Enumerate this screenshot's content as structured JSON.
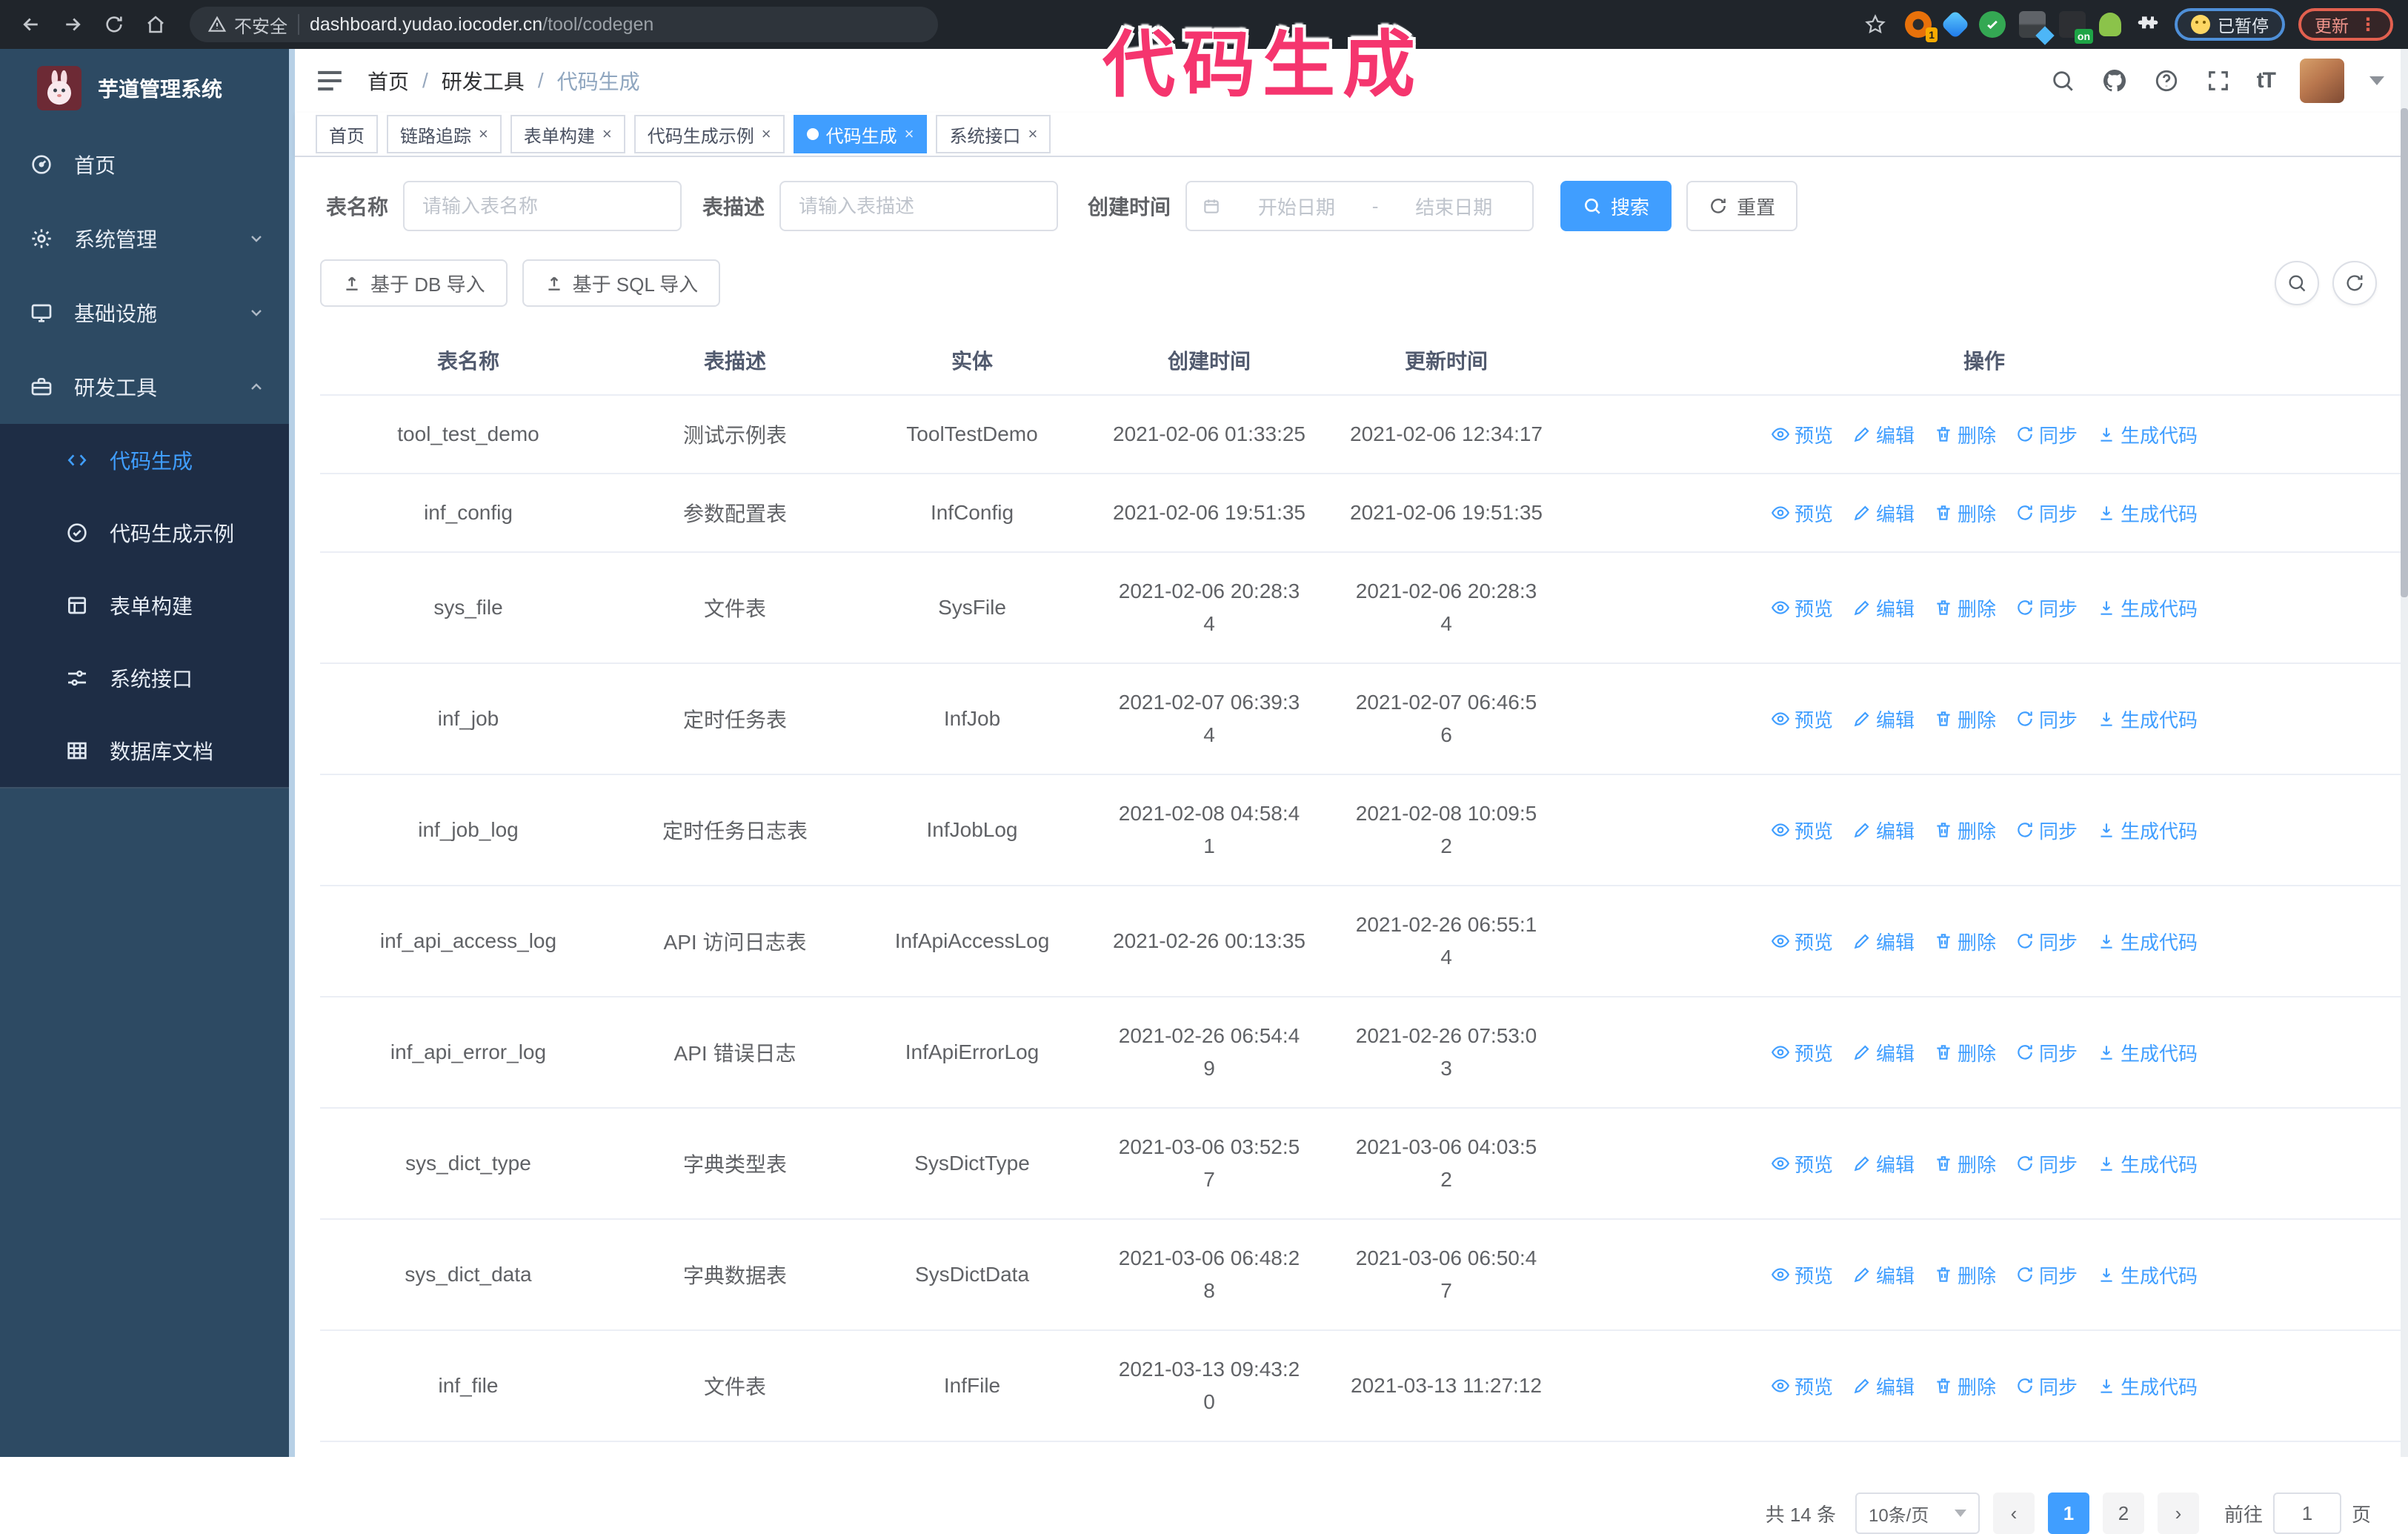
{
  "browser": {
    "security_label": "不安全",
    "url_host": "dashboard.yudao.iocoder.cn",
    "url_path": "/tool/codegen",
    "paused_badge": "已暂停",
    "update_label": "更新",
    "ext_badge_one": "1",
    "ext_badge_on": "on"
  },
  "annotation": {
    "text": "代码生成",
    "color": "#f5356e"
  },
  "sidebar": {
    "title": "芋道管理系统",
    "items": [
      {
        "label": "首页"
      },
      {
        "label": "系统管理"
      },
      {
        "label": "基础设施"
      },
      {
        "label": "研发工具"
      }
    ],
    "submenu": [
      {
        "label": "代码生成"
      },
      {
        "label": "代码生成示例"
      },
      {
        "label": "表单构建"
      },
      {
        "label": "系统接口"
      },
      {
        "label": "数据库文档"
      }
    ]
  },
  "header": {
    "breadcrumb": [
      "首页",
      "研发工具",
      "代码生成"
    ]
  },
  "tabs": [
    {
      "label": "首页"
    },
    {
      "label": "链路追踪"
    },
    {
      "label": "表单构建"
    },
    {
      "label": "代码生成示例"
    },
    {
      "label": "代码生成"
    },
    {
      "label": "系统接口"
    }
  ],
  "filters": {
    "table_name_label": "表名称",
    "table_name_placeholder": "请输入表名称",
    "table_desc_label": "表描述",
    "table_desc_placeholder": "请输入表描述",
    "create_time_label": "创建时间",
    "date_start_placeholder": "开始日期",
    "date_separator": "-",
    "date_end_placeholder": "结束日期",
    "search_label": "搜索",
    "reset_label": "重置"
  },
  "toolbar": {
    "import_db": "基于 DB 导入",
    "import_sql": "基于 SQL 导入"
  },
  "table": {
    "columns": [
      "表名称",
      "表描述",
      "实体",
      "创建时间",
      "更新时间",
      "操作"
    ],
    "actions": [
      "预览",
      "编辑",
      "删除",
      "同步",
      "生成代码"
    ],
    "rows": [
      {
        "name": "tool_test_demo",
        "desc": "测试示例表",
        "entity": "ToolTestDemo",
        "created": "2021-02-06 01:33:25",
        "updated": "2021-02-06 12:34:17"
      },
      {
        "name": "inf_config",
        "desc": "参数配置表",
        "entity": "InfConfig",
        "created": "2021-02-06 19:51:35",
        "updated": "2021-02-06 19:51:35"
      },
      {
        "name": "sys_file",
        "desc": "文件表",
        "entity": "SysFile",
        "created": "2021-02-06 20:28:3\n4",
        "updated": "2021-02-06 20:28:3\n4"
      },
      {
        "name": "inf_job",
        "desc": "定时任务表",
        "entity": "InfJob",
        "created": "2021-02-07 06:39:3\n4",
        "updated": "2021-02-07 06:46:5\n6"
      },
      {
        "name": "inf_job_log",
        "desc": "定时任务日志表",
        "entity": "InfJobLog",
        "created": "2021-02-08 04:58:4\n1",
        "updated": "2021-02-08 10:09:5\n2"
      },
      {
        "name": "inf_api_access_log",
        "desc": "API 访问日志表",
        "entity": "InfApiAccessLog",
        "created": "2021-02-26 00:13:35",
        "updated": "2021-02-26 06:55:1\n4"
      },
      {
        "name": "inf_api_error_log",
        "desc": "API 错误日志",
        "entity": "InfApiErrorLog",
        "created": "2021-02-26 06:54:4\n9",
        "updated": "2021-02-26 07:53:0\n3"
      },
      {
        "name": "sys_dict_type",
        "desc": "字典类型表",
        "entity": "SysDictType",
        "created": "2021-03-06 03:52:5\n7",
        "updated": "2021-03-06 04:03:5\n2"
      },
      {
        "name": "sys_dict_data",
        "desc": "字典数据表",
        "entity": "SysDictData",
        "created": "2021-03-06 06:48:2\n8",
        "updated": "2021-03-06 06:50:4\n7"
      },
      {
        "name": "inf_file",
        "desc": "文件表",
        "entity": "InfFile",
        "created": "2021-03-13 09:43:2\n0",
        "updated": "2021-03-13 11:27:12"
      }
    ]
  },
  "pagination": {
    "total": "共 14 条",
    "page_size": "10条/页",
    "pages": [
      "1",
      "2"
    ],
    "goto_label": "前往",
    "goto_value": "1",
    "page_suffix": "页"
  }
}
